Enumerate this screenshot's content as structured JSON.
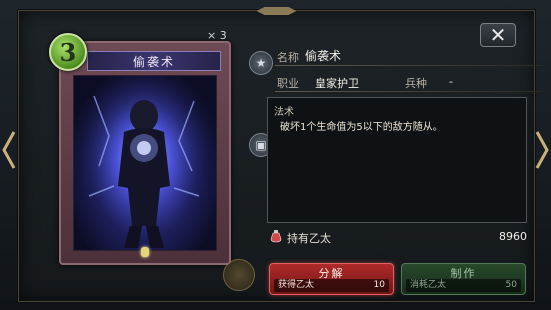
{
  "card": {
    "name": "偷袭术",
    "cost": "3",
    "count": "× 3"
  },
  "info": {
    "name_label": "名称",
    "name_value": "偷袭术",
    "class_label": "职业",
    "class_value": "皇家护卫",
    "type_label": "兵种",
    "type_value": "-",
    "skill_tag": "法术",
    "skill_text": "破坏1个生命值为5以下的敌方随从。"
  },
  "ether": {
    "label": "持有乙太",
    "value": "8960"
  },
  "buttons": {
    "decompose": {
      "title": "分解",
      "sub_label": "获得乙太",
      "sub_value": "10"
    },
    "craft": {
      "title": "制作",
      "sub_label": "消耗乙太",
      "sub_value": "50"
    }
  },
  "icons": {
    "close": "close-icon",
    "prev": "chevron-left-icon",
    "next": "chevron-right-icon",
    "star": "star-icon",
    "card_type": "card-type-icon",
    "ether": "ether-potion-icon"
  },
  "colors": {
    "cost_gem": "#4e8f1f",
    "decompose": "#b02a2a",
    "craft": "#284a2c",
    "frame": "#8d6a72"
  }
}
